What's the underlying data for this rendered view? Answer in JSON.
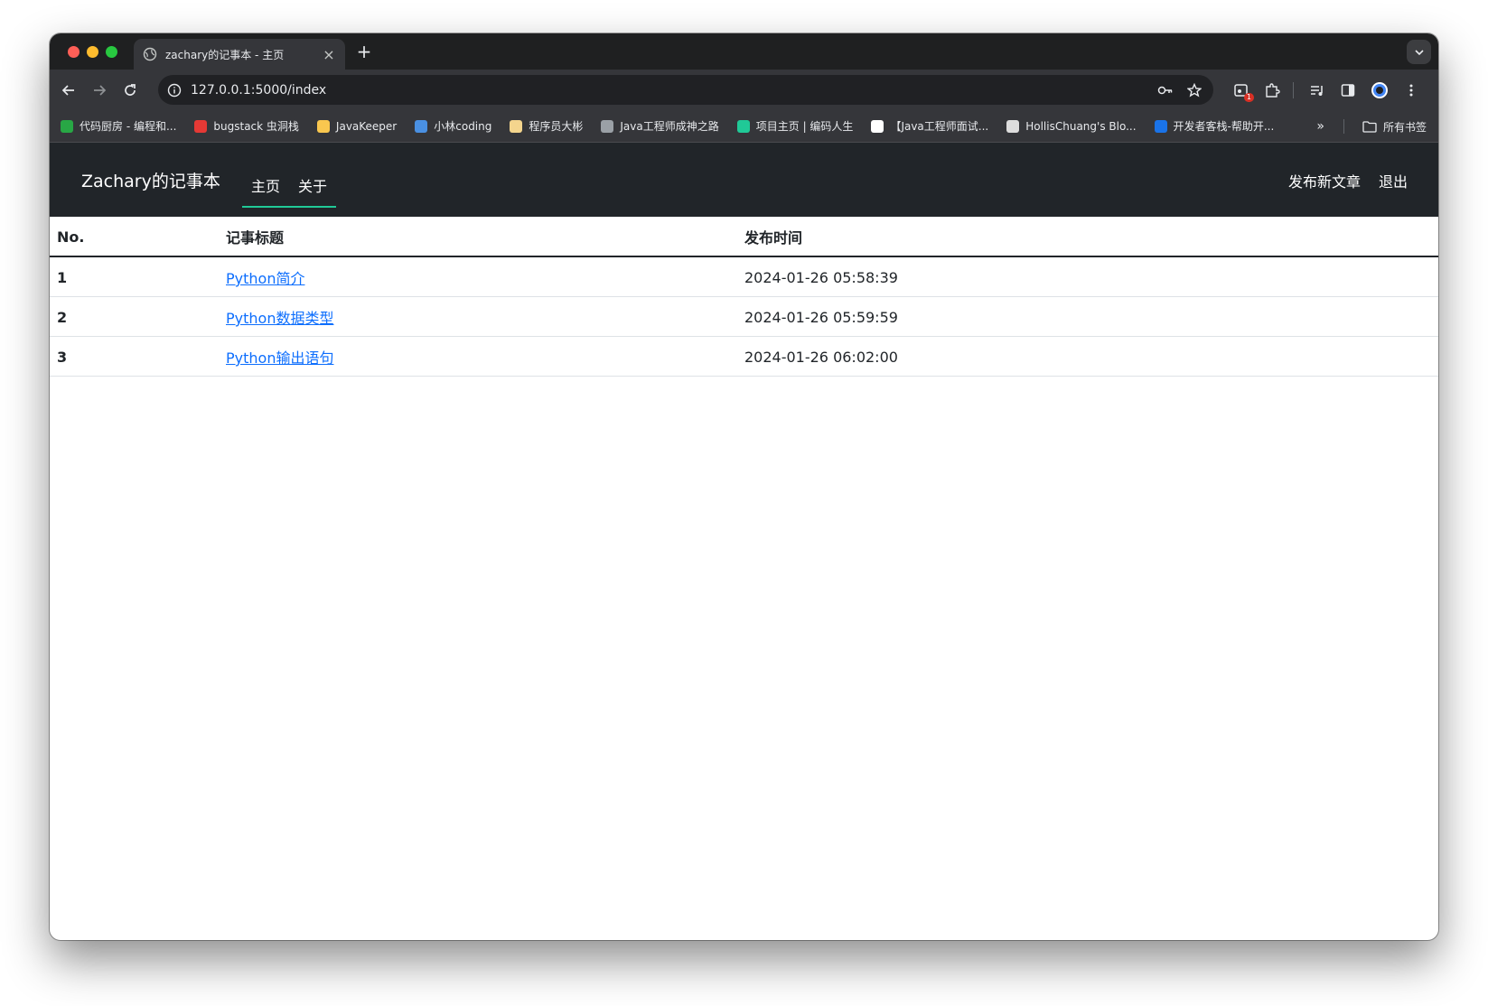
{
  "browser": {
    "tab_title": "zachary的记事本 - 主页",
    "new_tab_label": "+",
    "url": "127.0.0.1:5000/index",
    "extension_badge": "1",
    "bookmarks": [
      {
        "label": "代码厨房 - 编程和...",
        "icon": "code-kitchen-icon",
        "color": "#28a745"
      },
      {
        "label": "bugstack 虫洞栈",
        "icon": "bugstack-icon",
        "color": "#e53935"
      },
      {
        "label": "JavaKeeper",
        "icon": "javakeeper-icon",
        "color": "#f9c74f"
      },
      {
        "label": "小林coding",
        "icon": "xiaolin-icon",
        "color": "#4a90e2"
      },
      {
        "label": "程序员大彬",
        "icon": "dabin-icon",
        "color": "#f4d58d"
      },
      {
        "label": "Java工程师成神之路",
        "icon": "globe-icon",
        "color": "#9aa0a6"
      },
      {
        "label": "项目主页 | 编码人生",
        "icon": "w-icon",
        "color": "#20c997"
      },
      {
        "label": "【Java工程师面试...",
        "icon": "interview-icon",
        "color": "#ffffff"
      },
      {
        "label": "HollisChuang's Blo...",
        "icon": "hollis-icon",
        "color": "#dddddd"
      },
      {
        "label": "开发者客栈-帮助开...",
        "icon": "house-icon",
        "color": "#1a73e8"
      }
    ],
    "more_bookmarks": "»",
    "all_bookmarks": "所有书签"
  },
  "navbar": {
    "brand": "Zachary的记事本",
    "links": [
      "主页",
      "关于"
    ],
    "publish": "发布新文章",
    "logout": "退出"
  },
  "table": {
    "headers": [
      "No.",
      "记事标题",
      "发布时间"
    ],
    "rows": [
      {
        "no": "1",
        "title": "Python简介",
        "time": "2024-01-26 05:58:39"
      },
      {
        "no": "2",
        "title": "Python数据类型",
        "time": "2024-01-26 05:59:59"
      },
      {
        "no": "3",
        "title": "Python输出语句",
        "time": "2024-01-26 06:02:00"
      }
    ]
  },
  "colors": {
    "navbar_bg": "#212529",
    "accent": "#20c997",
    "link": "#0d6efd"
  }
}
